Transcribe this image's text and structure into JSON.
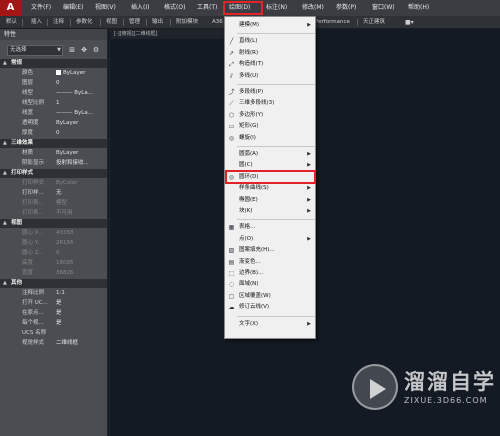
{
  "app": {
    "logo": "A"
  },
  "menubar": {
    "items": [
      "文件(F)",
      "编辑(E)",
      "视图(V)",
      "插入(I)",
      "格式(O)",
      "工具(T)",
      "绘图(D)",
      "标注(N)",
      "修改(M)",
      "参数(P)",
      "窗口(W)",
      "帮助(H)"
    ]
  },
  "ribbon": {
    "items": [
      "默认",
      "插入",
      "注释",
      "参数化",
      "视图",
      "管理",
      "输出",
      "附加模块",
      "A36",
      "Performance",
      "天正建筑"
    ]
  },
  "drawing_tab": {
    "label": "[-][俯视][二维线框]"
  },
  "properties": {
    "title": "特性",
    "selection": "无选择",
    "sections": [
      {
        "title": "常规",
        "rows": [
          {
            "label": "颜色",
            "value": "ByLayer",
            "swatch": true
          },
          {
            "label": "图层",
            "value": "0"
          },
          {
            "label": "线型",
            "value": "——— ByLa..."
          },
          {
            "label": "线型比例",
            "value": "1"
          },
          {
            "label": "线宽",
            "value": "——— ByLa..."
          },
          {
            "label": "透明度",
            "value": "ByLayer"
          },
          {
            "label": "厚度",
            "value": "0"
          }
        ]
      },
      {
        "title": "三维效果",
        "rows": [
          {
            "label": "材质",
            "value": "ByLayer"
          },
          {
            "label": "阴影显示",
            "value": "投射和接收..."
          }
        ]
      },
      {
        "title": "打印样式",
        "rows": [
          {
            "label": "打印样式",
            "value": "ByColor",
            "dim": true
          },
          {
            "label": "打印样...",
            "value": "无"
          },
          {
            "label": "打印表...",
            "value": "模型",
            "dim": true
          },
          {
            "label": "打印表...",
            "value": "不可用",
            "dim": true
          }
        ]
      },
      {
        "title": "视图",
        "rows": [
          {
            "label": "圆心 X...",
            "value": "43358",
            "dim": true
          },
          {
            "label": "圆心 Y...",
            "value": "26156",
            "dim": true
          },
          {
            "label": "圆心 Z...",
            "value": "0",
            "dim": true
          },
          {
            "label": "高度",
            "value": "18095",
            "dim": true
          },
          {
            "label": "宽度",
            "value": "36826",
            "dim": true
          }
        ]
      },
      {
        "title": "其他",
        "rows": [
          {
            "label": "注释比例",
            "value": "1:1"
          },
          {
            "label": "打开 UC...",
            "value": "是"
          },
          {
            "label": "在原点...",
            "value": "是"
          },
          {
            "label": "每个视...",
            "value": "是"
          },
          {
            "label": "UCS 名称",
            "value": ""
          },
          {
            "label": "视觉样式",
            "value": "二维线框"
          }
        ]
      }
    ]
  },
  "draw_menu": {
    "items": [
      {
        "label": "建模(M)",
        "icon": "none",
        "submenu": true
      },
      {
        "sep": true
      },
      {
        "label": "直线(L)",
        "icon": "line-icon"
      },
      {
        "label": "射线(R)",
        "icon": "ray-icon"
      },
      {
        "label": "构造线(T)",
        "icon": "xline-icon"
      },
      {
        "label": "多线(U)",
        "icon": "mline-icon"
      },
      {
        "sep": true
      },
      {
        "label": "多段线(P)",
        "icon": "polyline-icon"
      },
      {
        "label": "三维多段线(3)",
        "icon": "3dpoly-icon"
      },
      {
        "label": "多边形(Y)",
        "icon": "polygon-icon"
      },
      {
        "label": "矩形(G)",
        "icon": "rectangle-icon"
      },
      {
        "label": "螺旋(I)",
        "icon": "helix-icon"
      },
      {
        "sep": true
      },
      {
        "label": "圆弧(A)",
        "icon": "none",
        "submenu": true
      },
      {
        "label": "圆(C)",
        "icon": "none",
        "submenu": true
      },
      {
        "label": "圆环(D)",
        "icon": "donut-icon",
        "highlighted": true
      },
      {
        "label": "样条曲线(S)",
        "icon": "none",
        "submenu": true
      },
      {
        "label": "椭圆(E)",
        "icon": "none",
        "submenu": true
      },
      {
        "label": "块(K)",
        "icon": "none",
        "submenu": true
      },
      {
        "sep": true
      },
      {
        "label": "表格...",
        "icon": "table-icon"
      },
      {
        "label": "点(O)",
        "icon": "none",
        "submenu": true
      },
      {
        "label": "图案填充(H)...",
        "icon": "hatch-icon"
      },
      {
        "label": "渐变色...",
        "icon": "gradient-icon"
      },
      {
        "label": "边界(B)...",
        "icon": "boundary-icon"
      },
      {
        "label": "面域(N)",
        "icon": "region-icon"
      },
      {
        "label": "区域覆盖(W)",
        "icon": "wipeout-icon"
      },
      {
        "label": "修订云线(V)",
        "icon": "revcloud-icon"
      },
      {
        "sep": true
      },
      {
        "label": "文字(X)",
        "icon": "none",
        "submenu": true
      }
    ]
  },
  "watermark": {
    "brand": "溜溜自学",
    "url": "ZIXUE.3D66.COM"
  },
  "colors": {
    "highlight_red": "#e0242a",
    "panel_bg": "#4a4d52",
    "canvas_bg": "#141a24",
    "menu_bg": "#f0f0f0"
  }
}
